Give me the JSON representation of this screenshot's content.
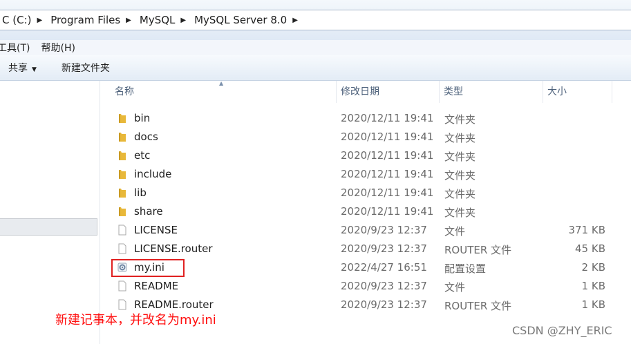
{
  "address": {
    "crumbs": [
      "C (C:)",
      "Program Files",
      "MySQL",
      "MySQL Server 8.0"
    ]
  },
  "menu": {
    "tools": "工具(T)",
    "help": "帮助(H)"
  },
  "toolbar": {
    "share": "共享",
    "new_folder": "新建文件夹"
  },
  "columns": {
    "name": "名称",
    "modified": "修改日期",
    "type": "类型",
    "size": "大小"
  },
  "files": [
    {
      "name": "bin",
      "date": "2020/12/11 19:41",
      "type": "文件夹",
      "size": "",
      "icon": "folder-icon"
    },
    {
      "name": "docs",
      "date": "2020/12/11 19:41",
      "type": "文件夹",
      "size": "",
      "icon": "folder-icon"
    },
    {
      "name": "etc",
      "date": "2020/12/11 19:41",
      "type": "文件夹",
      "size": "",
      "icon": "folder-icon"
    },
    {
      "name": "include",
      "date": "2020/12/11 19:41",
      "type": "文件夹",
      "size": "",
      "icon": "folder-icon"
    },
    {
      "name": "lib",
      "date": "2020/12/11 19:41",
      "type": "文件夹",
      "size": "",
      "icon": "folder-icon"
    },
    {
      "name": "share",
      "date": "2020/12/11 19:41",
      "type": "文件夹",
      "size": "",
      "icon": "folder-icon"
    },
    {
      "name": "LICENSE",
      "date": "2020/9/23 12:37",
      "type": "文件",
      "size": "371 KB",
      "icon": "file-icon"
    },
    {
      "name": "LICENSE.router",
      "date": "2020/9/23 12:37",
      "type": "ROUTER 文件",
      "size": "45 KB",
      "icon": "file-icon"
    },
    {
      "name": "my.ini",
      "date": "2022/4/27 16:51",
      "type": "配置设置",
      "size": "2 KB",
      "icon": "config-file-icon"
    },
    {
      "name": "README",
      "date": "2020/9/23 12:37",
      "type": "文件",
      "size": "1 KB",
      "icon": "file-icon"
    },
    {
      "name": "README.router",
      "date": "2020/9/23 12:37",
      "type": "ROUTER 文件",
      "size": "1 KB",
      "icon": "file-icon"
    }
  ],
  "annotation": "新建记事本，并改名为my.ini",
  "watermark": "CSDN @ZHY_ERIC",
  "colors": {
    "annotation": "#ff1010",
    "highlight_box": "#e02020",
    "folder": "#e8b83a"
  }
}
